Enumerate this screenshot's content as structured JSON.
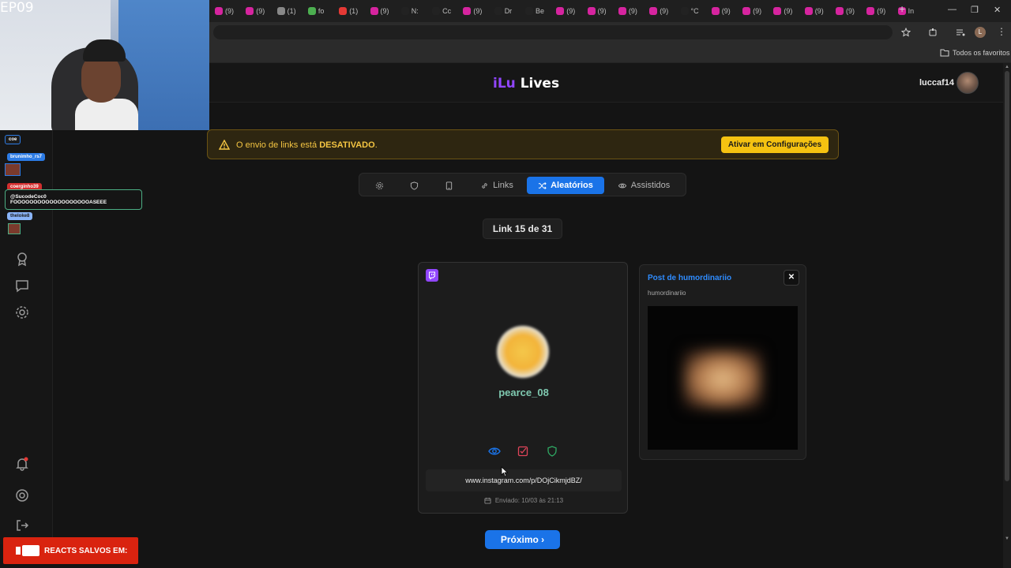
{
  "browser": {
    "tab_texts": [
      "(9)",
      "(9)",
      "(1)",
      "fo",
      "(1)",
      "(9)",
      "N:",
      "Cc",
      "(9)",
      "Dr",
      "Be",
      "(9)",
      "(9)",
      "(9)",
      "(9)",
      "°C",
      "(9)",
      "(9)",
      "(9)",
      "(9)",
      "(9)",
      "(9)",
      "In"
    ],
    "new_tab": "+",
    "bookmarks_folder": "Todos os favoritos",
    "profile_initial": "L"
  },
  "overlay": {
    "episode": "EP09",
    "chat_names": [
      "coe",
      "brunimho_rs7",
      "coerginho39",
      "@SucodeCoc0 FOOOOOOOOOOOOOOOOOOOASEEE",
      "theloke8"
    ],
    "reacts_label": "REACTS SALVOS EM:"
  },
  "header": {
    "logo_accent": "iLu",
    "logo_text": "Lives",
    "username": "luccaf14"
  },
  "banner": {
    "text_prefix": "O envio de links está",
    "text_bold": "DESATIVADO",
    "text_suffix": ".",
    "button_label": "Ativar em Configurações"
  },
  "tabs": [
    {
      "label": "",
      "icon": "gear-icon"
    },
    {
      "label": "",
      "icon": "shield-icon"
    },
    {
      "label": "",
      "icon": "tablet-icon"
    },
    {
      "label": "Links",
      "icon": "link-icon"
    },
    {
      "label": "Aleatórios",
      "icon": "shuffle-icon",
      "active": true
    },
    {
      "label": "Assistidos",
      "icon": "eye-icon"
    }
  ],
  "counter": "Link 15 de 31",
  "card": {
    "username": "pearce_08",
    "url": "www.instagram.com/p/DOjCikmjdBZ/",
    "sent": "Enviado: 10/03 às 21:13"
  },
  "preview": {
    "title": "Post de humordinariio",
    "subtitle": "humordinariio",
    "close": "✕"
  },
  "next_button": "Próximo ›",
  "colors": {
    "accent": "#1a73e8",
    "warning": "#f5c211",
    "twitch": "#9146ff",
    "logo_accent": "#9146ff"
  }
}
